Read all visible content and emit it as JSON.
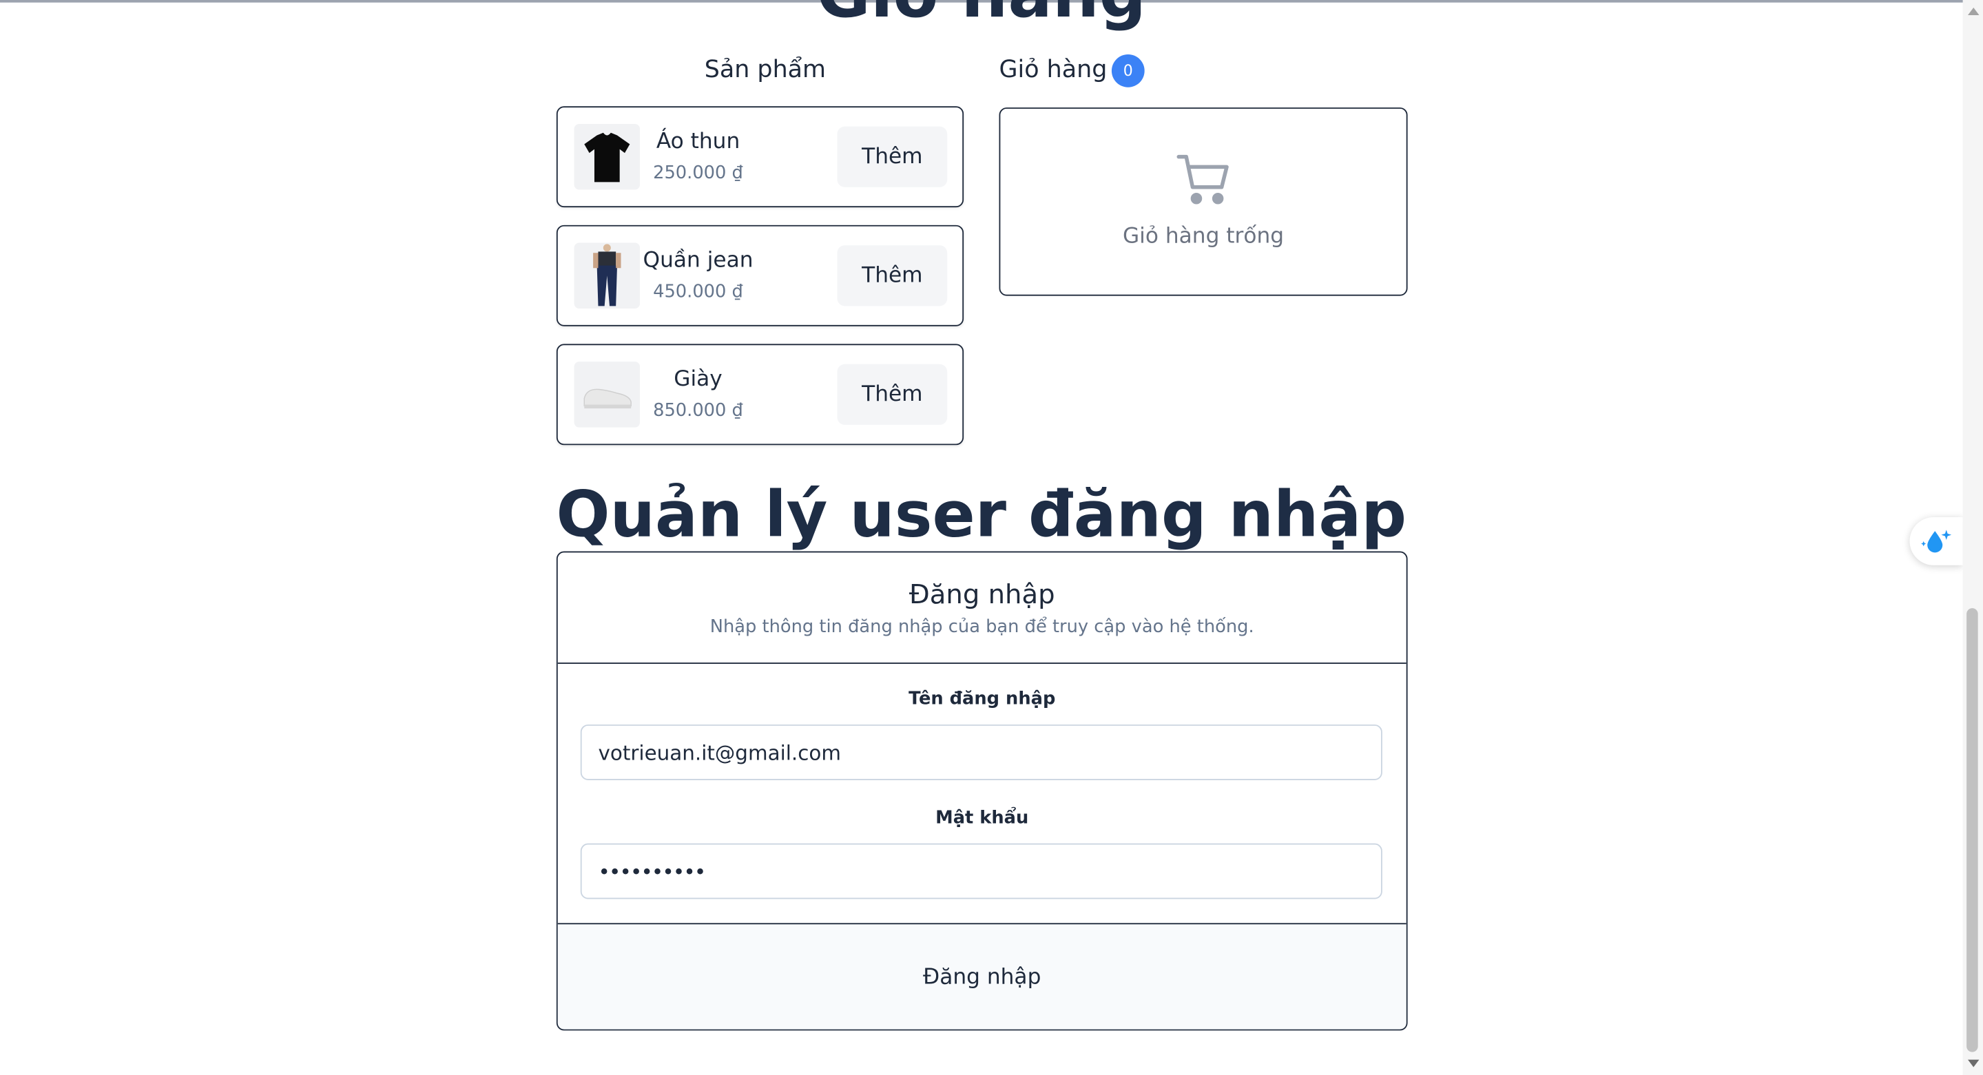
{
  "header": {
    "clipped_title": "Giỏ hàng"
  },
  "products": {
    "heading": "Sản phẩm",
    "items": [
      {
        "name": "Áo thun",
        "price": "250.000 ₫",
        "button": "Thêm"
      },
      {
        "name": "Quần jean",
        "price": "450.000 ₫",
        "button": "Thêm"
      },
      {
        "name": "Giày",
        "price": "850.000 ₫",
        "button": "Thêm"
      }
    ]
  },
  "cart": {
    "heading": "Giỏ hàng",
    "count": "0",
    "empty_text": "Giỏ hàng trống"
  },
  "login_section": {
    "title": "Quản lý user đăng nhập",
    "card_title": "Đăng nhập",
    "card_subtitle": "Nhập thông tin đăng nhập của bạn để truy cập vào hệ thống.",
    "username_label": "Tên đăng nhập",
    "username_value": "votrieuan.it@gmail.com",
    "password_label": "Mật khẩu",
    "password_value": "••••••••••",
    "submit_label": "Đăng nhập"
  },
  "colors": {
    "accent": "#3b82f6",
    "heading": "#1e2d45",
    "muted": "#64748b"
  }
}
